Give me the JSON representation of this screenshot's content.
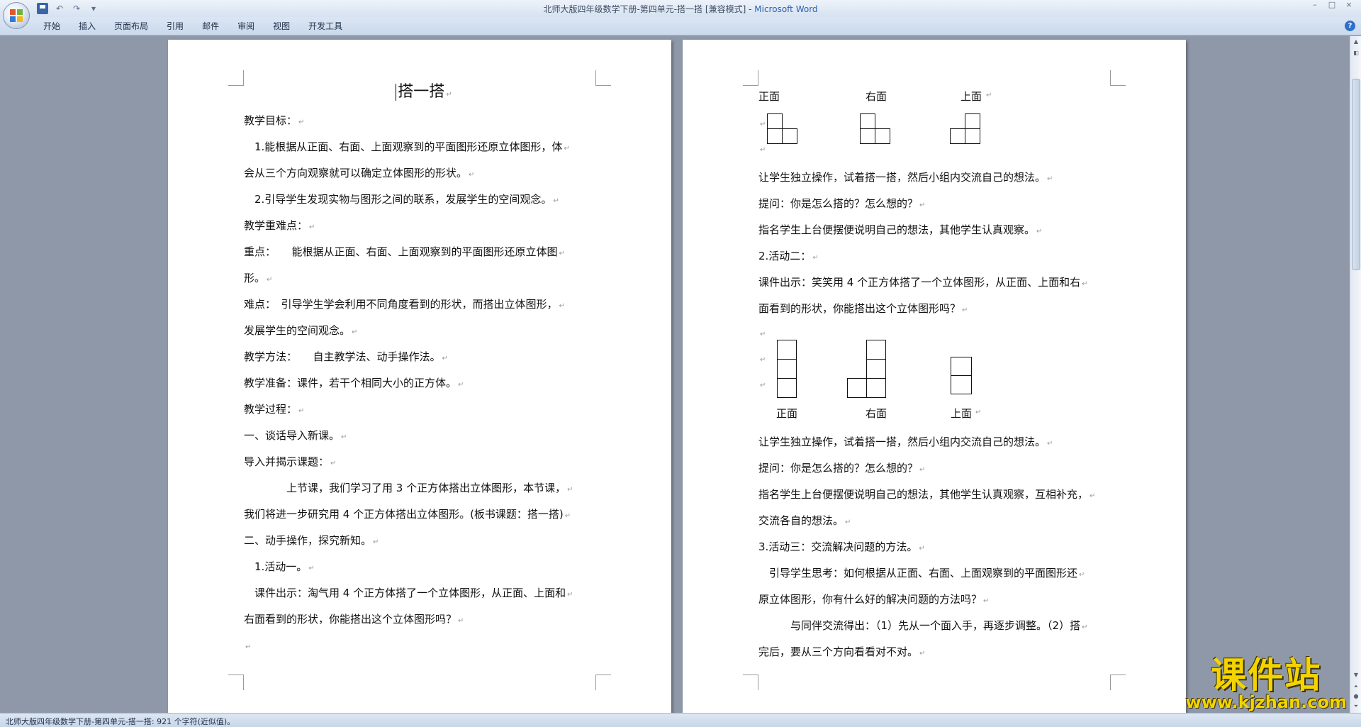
{
  "window": {
    "title_doc": "北师大版四年级数学下册-第四单元-搭一搭 [兼容模式]",
    "title_sep": " - ",
    "title_app": "Microsoft Word"
  },
  "ribbon": {
    "tabs": [
      "开始",
      "插入",
      "页面布局",
      "引用",
      "邮件",
      "审阅",
      "视图",
      "开发工具"
    ]
  },
  "page1": {
    "title": "搭一搭",
    "lines": [
      "教学目标：",
      "　1.能根据从正面、右面、上面观察到的平面图形还原立体图形，体",
      "会从三个方向观察就可以确定立体图形的形状。",
      "　2.引导学生发现实物与图形之间的联系，发展学生的空间观念。",
      "教学重难点：",
      "重点：　　能根据从正面、右面、上面观察到的平面图形还原立体图",
      "形。",
      "难点：　引导学生学会利用不同角度看到的形状，而搭出立体图形，",
      "发展学生的空间观念。",
      "教学方法：　　自主教学法、动手操作法。",
      "教学准备：课件，若干个相同大小的正方体。",
      "教学过程：",
      "一、谈话导入新课。",
      "导入并揭示课题：",
      "　　　　上节课，我们学习了用 3 个正方体搭出立体图形，本节课，",
      "我们将进一步研究用 4 个正方体搭出立体图形。(板书课题：搭一搭)",
      "二、动手操作，探究新知。",
      "　1.活动一。",
      "　课件出示：淘气用 4 个正方体搭了一个立体图形，从正面、上面和",
      "右面看到的形状，你能搭出这个立体图形吗？",
      ""
    ]
  },
  "page2": {
    "fig1_labels": [
      "正面",
      "右面",
      "上面"
    ],
    "lines_a": [
      "让学生独立操作，试着搭一搭，然后小组内交流自己的想法。",
      "提问：你是怎么搭的？怎么想的？",
      "指名学生上台便摆便说明自己的想法，其他学生认真观察。",
      "2.活动二：",
      "课件出示：笑笑用 4 个正方体搭了一个立体图形，从正面、上面和右",
      "面看到的形状，你能搭出这个立体图形吗？"
    ],
    "fig2_labels": [
      "正面",
      "右面",
      "上面"
    ],
    "lines_b": [
      "让学生独立操作，试着搭一搭，然后小组内交流自己的想法。",
      "提问：你是怎么搭的？怎么想的？",
      "指名学生上台便摆便说明自己的想法，其他学生认真观察，互相补充，",
      "交流各自的想法。",
      "3.活动三：交流解决问题的方法。",
      "　引导学生思考：如何根据从正面、右面、上面观察到的平面图形还",
      "原立体图形，你有什么好的解决问题的方法吗？",
      "　　　与同伴交流得出：（1）先从一个面入手，再逐步调整。（2）搭",
      "完后，要从三个方向看看对不对。"
    ]
  },
  "status": {
    "text": "北师大版四年级数学下册-第四单元-搭一搭: 921 个字符(近似值)。"
  },
  "watermark": {
    "name": "课件站",
    "url": "www.kjzhan.com"
  },
  "icons": {
    "office_button": "office-logo-icon",
    "save": "save-icon",
    "undo": "undo-icon",
    "redo": "redo-icon",
    "help": "help-icon"
  },
  "paragraph_mark": "↵"
}
